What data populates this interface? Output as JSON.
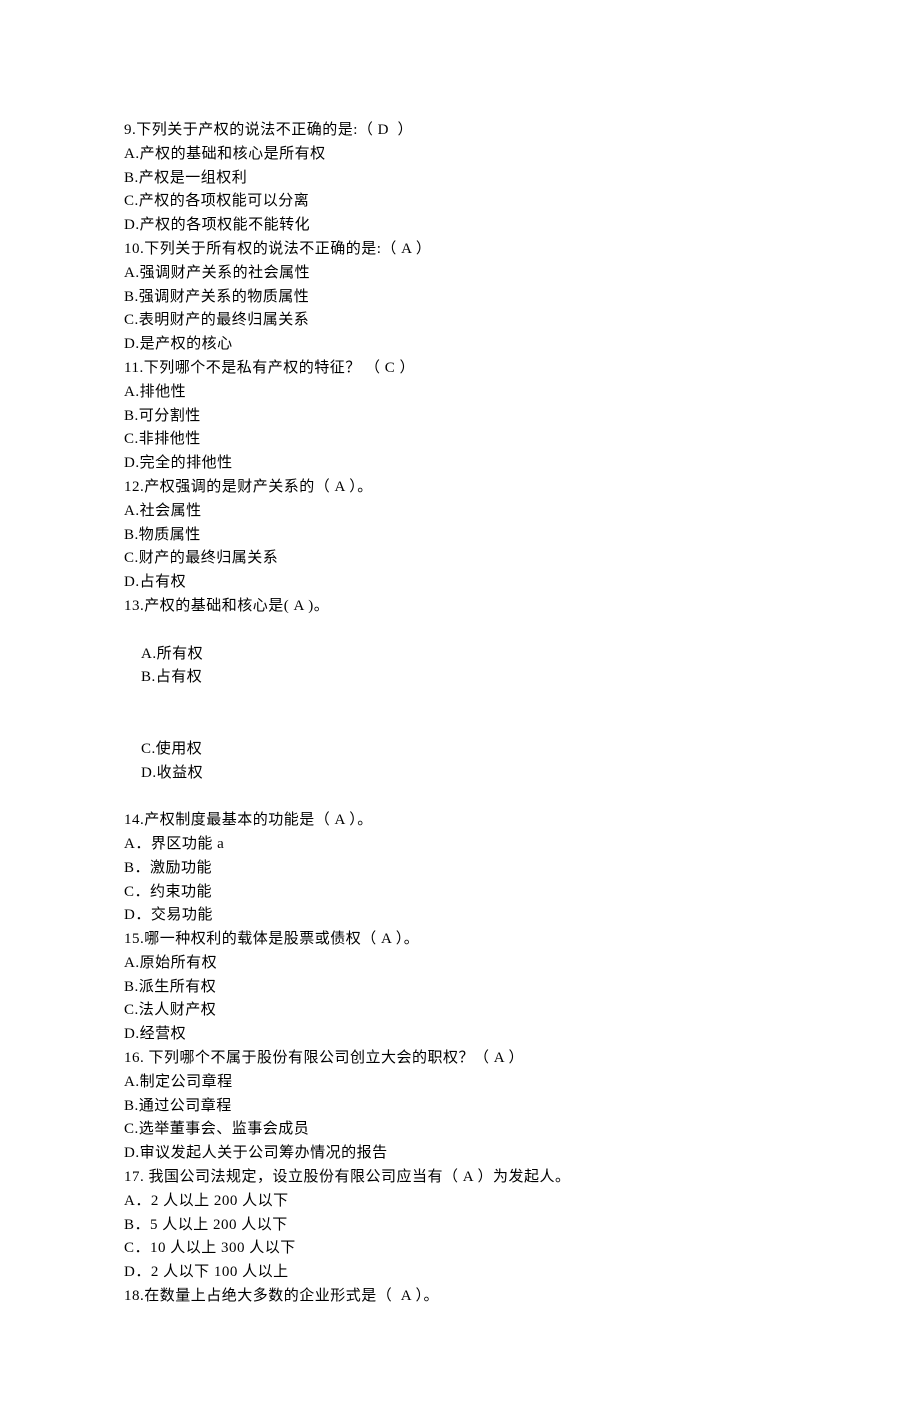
{
  "questions": [
    {
      "stem": "9.下列关于产权的说法不正确的是:（ D  ）",
      "options": [
        "A.产权的基础和核心是所有权",
        "B.产权是一组权利",
        "C.产权的各项权能可以分离",
        "D.产权的各项权能不能转化"
      ]
    },
    {
      "stem": "10.下列关于所有权的说法不正确的是:（ A ）",
      "options": [
        "A.强调财产关系的社会属性",
        "B.强调财产关系的物质属性",
        "C.表明财产的最终归属关系",
        "D.是产权的核心"
      ]
    },
    {
      "stem": "11.下列哪个不是私有产权的特征？ （ C ）",
      "options": [
        "A.排他性",
        "B.可分割性",
        "C.非排他性",
        "D.完全的排他性"
      ]
    },
    {
      "stem": "12.产权强调的是财产关系的（ A ）。",
      "options": [
        "A.社会属性",
        "B.物质属性",
        "C.财产的最终归属关系",
        "D.占有权"
      ]
    },
    {
      "stem": "13.产权的基础和核心是( A )。",
      "options_pairs": [
        {
          "left": "A.所有权",
          "right": "B.占有权"
        },
        {
          "left": "C.使用权",
          "right": "D.收益权"
        }
      ]
    },
    {
      "stem": "14.产权制度最基本的功能是（ A ）。",
      "options": [
        "A．界区功能 a",
        "B．激励功能",
        "C．约束功能",
        "D．交易功能"
      ]
    },
    {
      "stem": "15.哪一种权利的载体是股票或债权（ A ）。",
      "options": [
        "A.原始所有权",
        "B.派生所有权",
        "C.法人财产权",
        "D.经营权"
      ]
    },
    {
      "stem": "16. 下列哪个不属于股份有限公司创立大会的职权？（ A ）",
      "options": [
        "A.制定公司章程",
        "B.通过公司章程",
        "C.选举董事会、监事会成员",
        "D.审议发起人关于公司筹办情况的报告"
      ]
    },
    {
      "stem": "17. 我国公司法规定，设立股份有限公司应当有（ A ）为发起人。",
      "options": [
        "A．2 人以上 200 人以下",
        "B．5 人以上 200 人以下",
        "C．10 人以上 300 人以下",
        "D．2 人以下 100 人以上"
      ]
    },
    {
      "stem": "18.在数量上占绝大多数的企业形式是（  A ）。"
    }
  ]
}
